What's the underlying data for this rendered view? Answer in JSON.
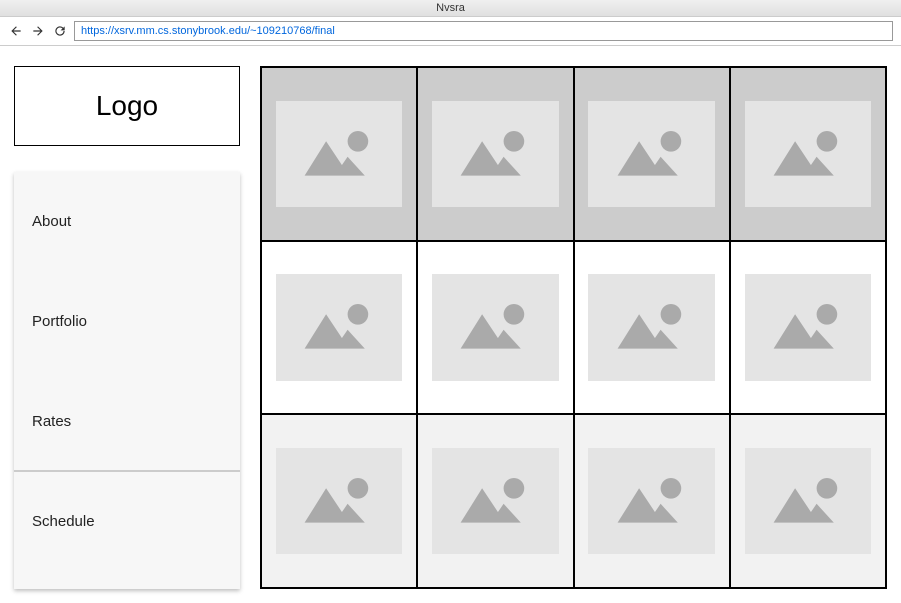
{
  "window": {
    "title": "Nvsra"
  },
  "toolbar": {
    "url": "https://xsrv.mm.cs.stonybrook.edu/~109210768/final"
  },
  "sidebar": {
    "logo_text": "Logo",
    "nav": [
      {
        "label": "About"
      },
      {
        "label": "Portfolio"
      },
      {
        "label": "Rates"
      },
      {
        "label": "Schedule"
      }
    ]
  },
  "grid": {
    "rows": 3,
    "cols": 4
  }
}
